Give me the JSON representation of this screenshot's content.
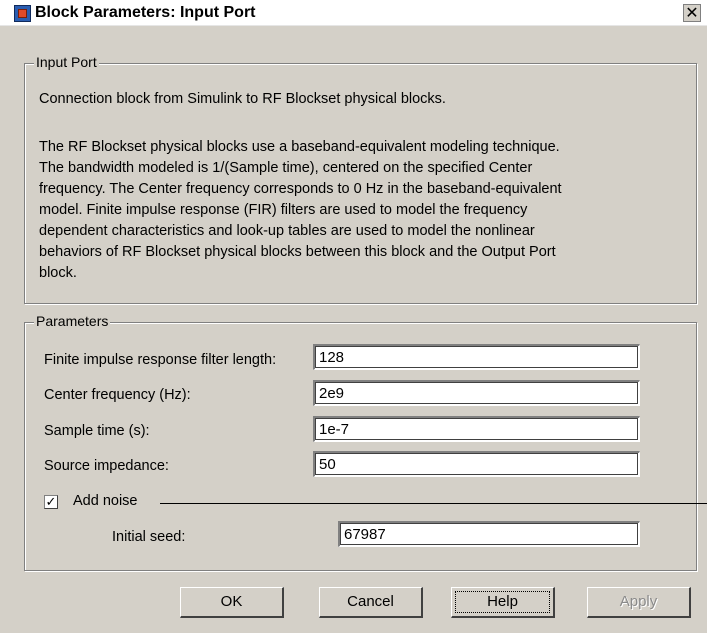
{
  "window": {
    "title": "Block Parameters: Input Port",
    "close_glyph": "✕"
  },
  "input_port": {
    "group_label": "Input Port",
    "summary": "Connection block from Simulink to RF Blockset physical blocks.",
    "description_lines": [
      "The RF Blockset physical blocks use a baseband-equivalent modeling technique.",
      "The bandwidth modeled is 1/(Sample time), centered on the specified Center",
      "frequency. The Center frequency corresponds to 0 Hz in the baseband-equivalent",
      "model. Finite impulse response (FIR) filters are used to model the frequency",
      "dependent characteristics and look-up tables are used to model the nonlinear",
      "behaviors of RF Blockset physical blocks between this block and the Output Port",
      "block."
    ]
  },
  "parameters": {
    "group_label": "Parameters",
    "fields": [
      {
        "label": "Finite impulse response filter length:",
        "value": "128"
      },
      {
        "label": "Center frequency (Hz):",
        "value": "2e9"
      },
      {
        "label": "Sample time (s):",
        "value": "1e-7"
      },
      {
        "label": "Source impedance:",
        "value": "50"
      }
    ],
    "add_noise": {
      "label": "Add noise",
      "checked": true,
      "check_glyph": "✓"
    },
    "initial_seed": {
      "label": "Initial seed:",
      "value": "67987"
    }
  },
  "buttons": {
    "ok": "OK",
    "cancel": "Cancel",
    "help": "Help",
    "apply": "Apply"
  },
  "colors": {
    "dialog_background": "#d4d0c8",
    "field_background": "#ffffff",
    "disabled_text": "#8a8a8a"
  },
  "icons": {
    "app": "simulink-block-icon",
    "close": "close-icon",
    "check": "checkmark-icon"
  }
}
